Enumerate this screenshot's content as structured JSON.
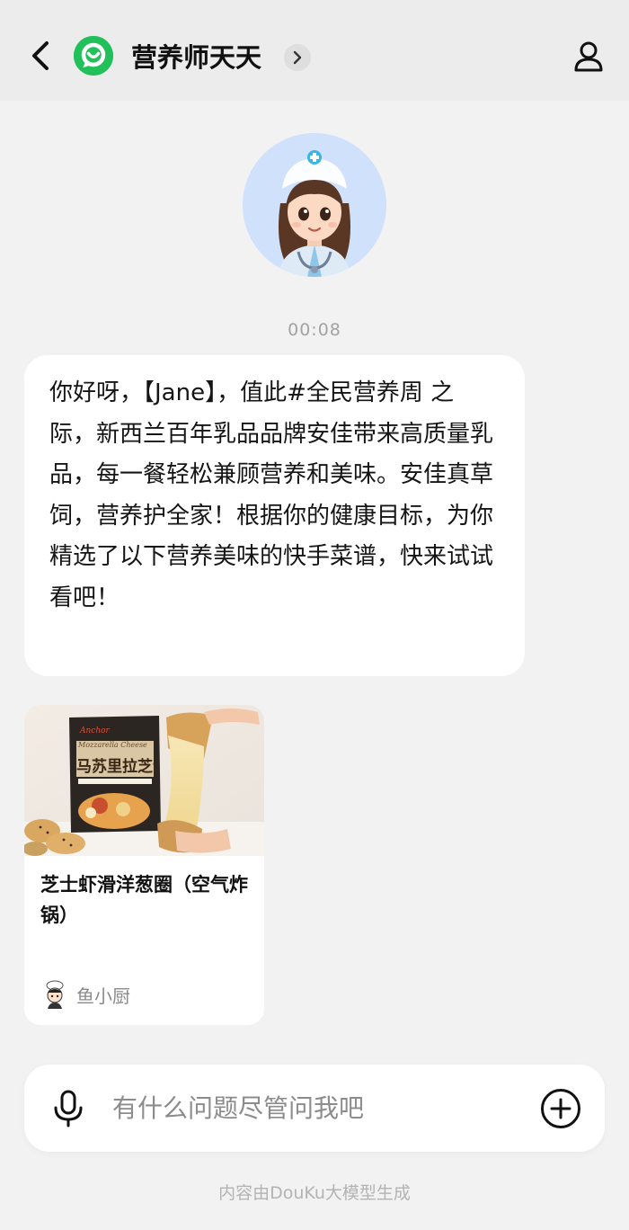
{
  "header": {
    "title": "营养师天天",
    "back_icon": "back-arrow-icon",
    "logo_icon": "chat-bot-logo-icon",
    "chevron_icon": "chevron-right-icon",
    "profile_icon": "user-profile-icon",
    "logo_color": "#22c05a"
  },
  "chat": {
    "avatar_icon": "nurse-avatar",
    "timestamp": "00:08",
    "message": "你好呀，【Jane】，值此#全民营养周 之际，新西兰百年乳品品牌安佳带来高质量乳品，每一餐轻松兼顾营养和美味。安佳真草饲，营养护全家！根据你的健康目标，为你精选了以下营养美味的快手菜谱，快来试试看吧！"
  },
  "recipe_card": {
    "title": "芝士虾滑洋葱圈（空气炸锅）",
    "author": "鱼小厨",
    "image": "cheese-pastry-photo",
    "package_brand": "Anchor",
    "package_title_en": "Mozzarella Cheese",
    "package_title_cn": "马苏里拉芝士"
  },
  "input": {
    "placeholder": "有什么问题尽管问我吧",
    "value": "",
    "mic_icon": "microphone-icon",
    "plus_icon": "plus-circle-icon"
  },
  "footer": {
    "note": "内容由DouKu大模型生成"
  }
}
